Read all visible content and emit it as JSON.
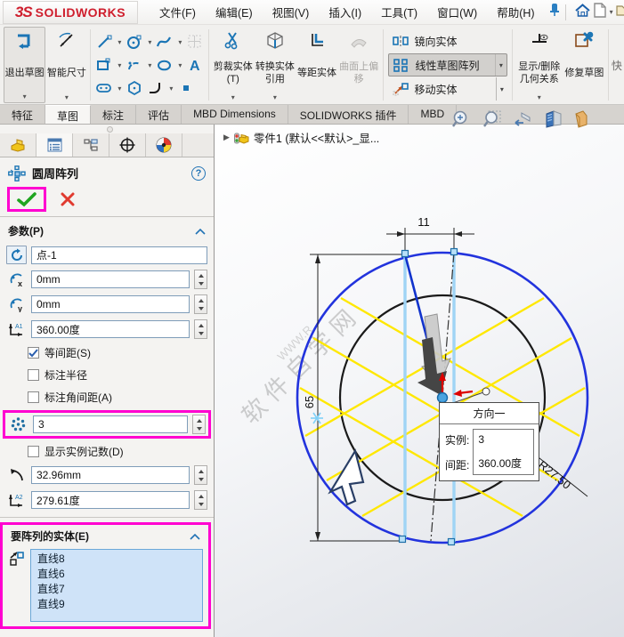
{
  "window": {
    "logo_text": "SOLIDWORKS",
    "logo_mark": "3S"
  },
  "menubar": {
    "menus": [
      "文件(F)",
      "编辑(E)",
      "视图(V)",
      "插入(I)",
      "工具(T)",
      "窗口(W)",
      "帮助(H)"
    ]
  },
  "ribbon": {
    "exit_sketch": "退出草图",
    "smart_dimension": "智能尺寸",
    "trim_entities": "剪裁实体(T)",
    "convert_entities": "转换实体引用",
    "offset_entities": "等距实体",
    "surface_offset": "曲面上偏移",
    "mirror_entities": "镜向实体",
    "linear_pattern": "线性草图阵列",
    "move_entities": "移动实体",
    "display_relations": "显示/删除几何关系",
    "repair_sketch": "修复草图",
    "quick_snaps": "快"
  },
  "tabs": {
    "items": [
      "特征",
      "草图",
      "标注",
      "评估",
      "MBD Dimensions",
      "SOLIDWORKS 插件",
      "MBD"
    ],
    "active": "草图"
  },
  "property_manager": {
    "title": "圆周阵列",
    "parameters": {
      "header": "参数(P)",
      "center_point": "点-1",
      "center_x": "0mm",
      "center_y": "0mm",
      "total_angle": "360.00度",
      "equal_spacing_label": "等间距(S)",
      "equal_spacing_checked": true,
      "dim_radius_label": "标注半径",
      "dim_radius_checked": false,
      "dim_angle_label": "标注角间距(A)",
      "dim_angle_checked": false,
      "instance_count": "3",
      "show_count_label": "显示实例记数(D)",
      "show_count_checked": false,
      "radius": "32.96mm",
      "arc_angle": "279.61度"
    },
    "entities": {
      "header": "要阵列的实体(E)",
      "items": [
        "直线8",
        "直线6",
        "直线7",
        "直线9"
      ]
    }
  },
  "feature_tree": {
    "part": "零件1  (默认<<默认>_显..."
  },
  "graphics": {
    "dimensions": {
      "width": "11",
      "height": "65",
      "radius": "R27.50"
    },
    "callout": {
      "title": "方向一",
      "rows": [
        {
          "label": "实例:",
          "value": "3"
        },
        {
          "label": "间距:",
          "value": "360.00度"
        }
      ]
    },
    "watermark": {
      "main": "软件自学网",
      "fragment": "WWW.R"
    }
  },
  "colors": {
    "highlight_box": "#ff00d0",
    "ok_green": "#1fa51f",
    "cancel_red": "#e03a2f",
    "selection_blue": "#2233dd",
    "preview_yellow": "#ffec00",
    "selected_line_blue": "#9fd4f5"
  }
}
